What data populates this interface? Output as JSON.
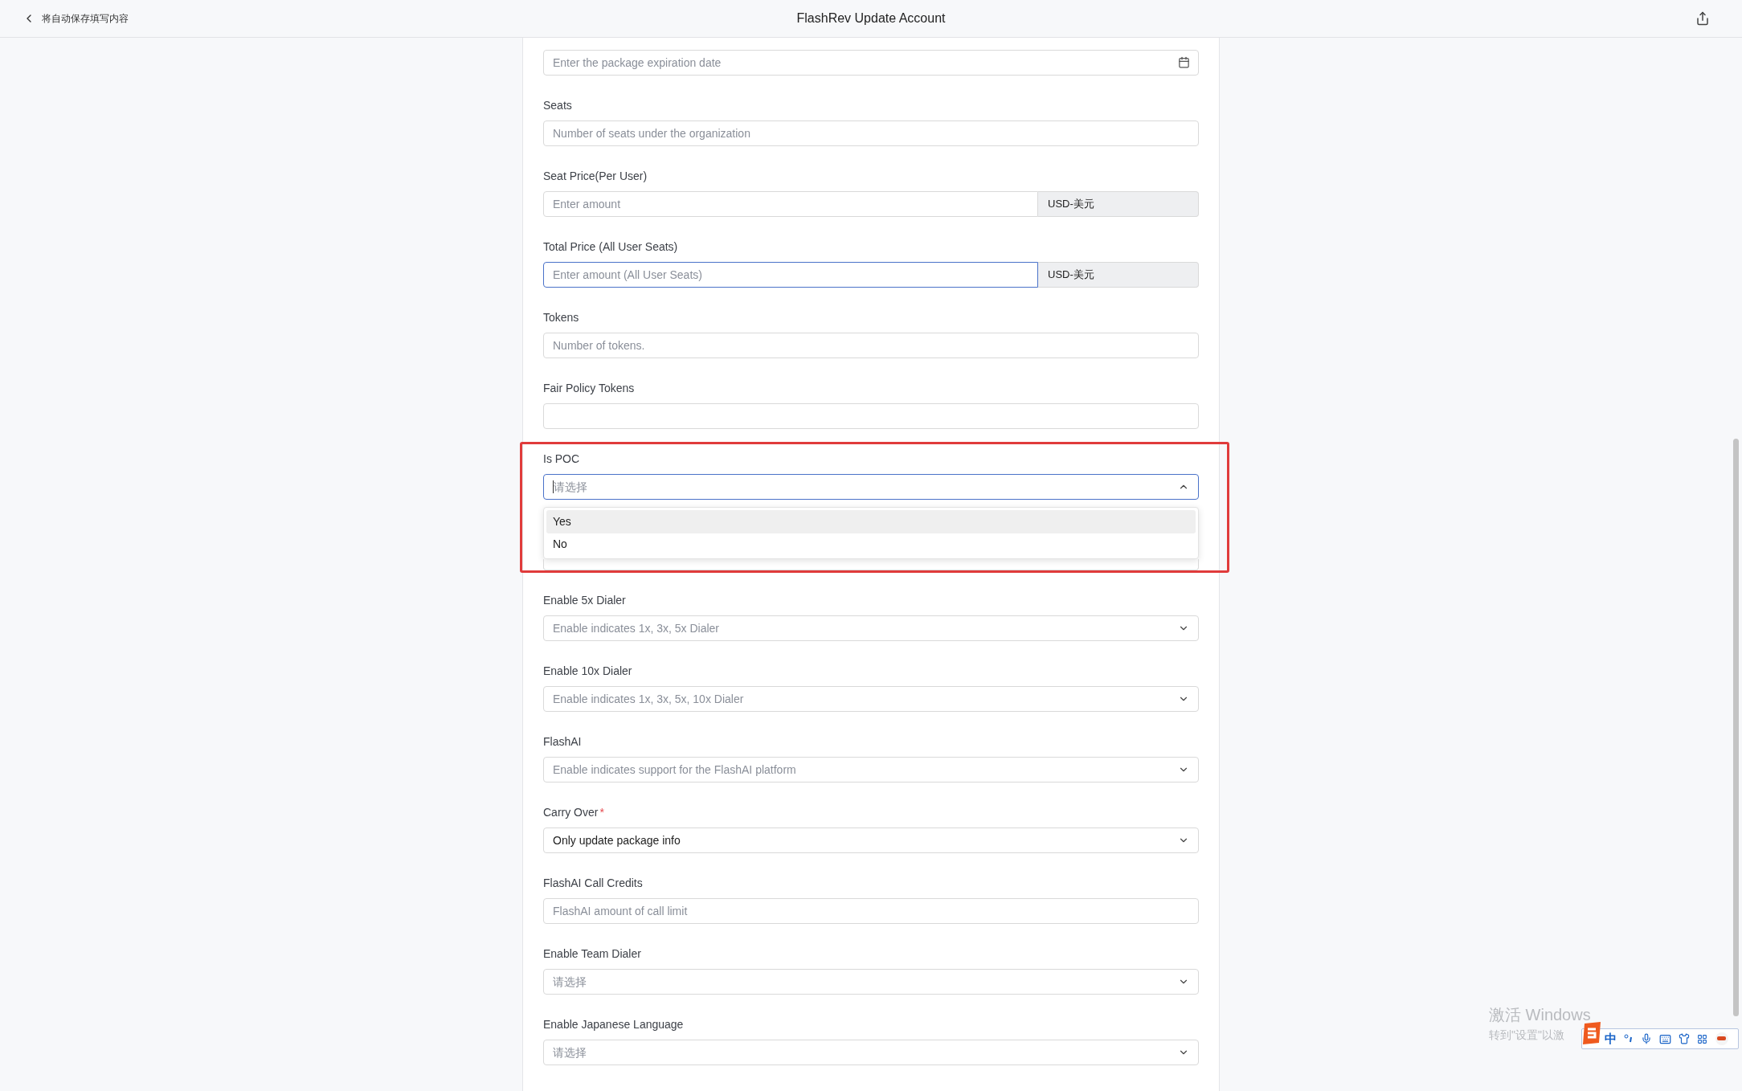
{
  "header": {
    "back_label": "将自动保存填写内容",
    "title": "FlashRev Update Account"
  },
  "fields": [
    {
      "kind": "date",
      "placeholder": "Enter the package expiration date"
    },
    {
      "kind": "text",
      "label": "Seats",
      "placeholder": "Number of seats under the organization"
    },
    {
      "kind": "currency",
      "label": "Seat Price(Per User)",
      "placeholder": "Enter amount",
      "unit": "USD-美元",
      "focused": false
    },
    {
      "kind": "currency",
      "label": "Total Price (All User Seats)",
      "placeholder": "Enter amount (All User Seats)",
      "unit": "USD-美元",
      "focused": true
    },
    {
      "kind": "text",
      "label": "Tokens",
      "placeholder": "Number of tokens."
    },
    {
      "kind": "text",
      "label": "Fair Policy Tokens"
    },
    {
      "kind": "select",
      "label": "Is POC",
      "placeholder": "请选择",
      "expanded": true,
      "highlighted_frame": true,
      "options": [
        {
          "label": "Yes",
          "highlighted": true
        },
        {
          "label": "No",
          "highlighted": false
        }
      ]
    },
    {
      "kind": "select",
      "label": "Enable 5x Dialer",
      "placeholder": "Enable indicates 1x, 3x, 5x Dialer",
      "expanded": false
    },
    {
      "kind": "select",
      "label": "Enable 10x Dialer",
      "placeholder": "Enable indicates 1x, 3x, 5x, 10x Dialer",
      "expanded": false
    },
    {
      "kind": "select",
      "label": "FlashAI",
      "placeholder": "Enable indicates support for the FlashAI platform",
      "expanded": false
    },
    {
      "kind": "select",
      "label": "Carry Over",
      "required_mark": "*",
      "value": "Only update package info",
      "expanded": false
    },
    {
      "kind": "text",
      "label": "FlashAI Call Credits",
      "placeholder": "FlashAI amount of call limit"
    },
    {
      "kind": "select",
      "label": "Enable Team Dialer",
      "placeholder": "请选择",
      "expanded": false
    },
    {
      "kind": "select",
      "label": "Enable Japanese Language",
      "placeholder": "请选择",
      "expanded": false
    }
  ],
  "activation_notice": {
    "title": "激活 Windows",
    "subtitle": "转到\"设置\"以激"
  },
  "ime_toolbar": {
    "mode": "中"
  }
}
